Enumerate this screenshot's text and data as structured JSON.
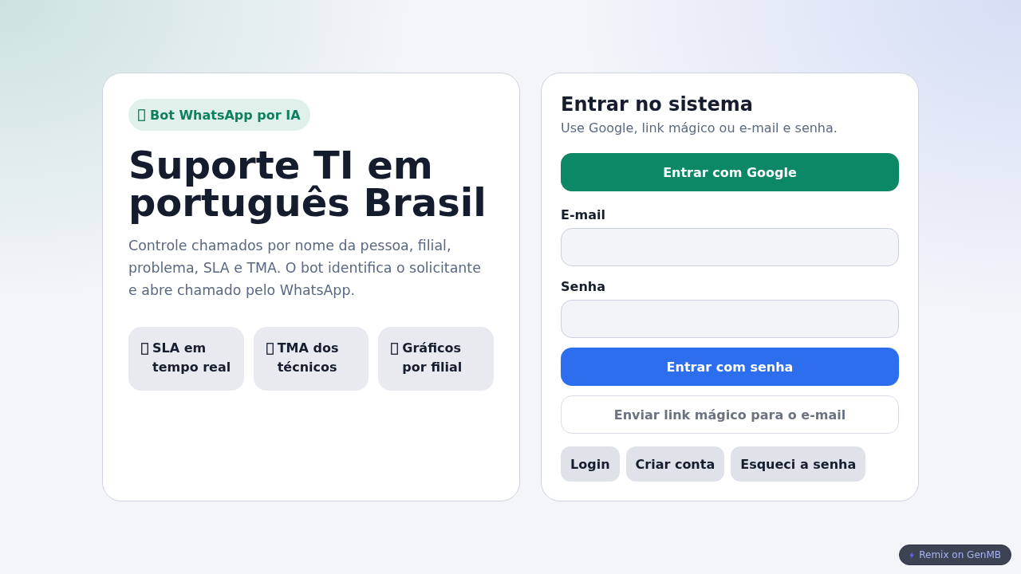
{
  "intro": {
    "badge": "Bot WhatsApp por IA",
    "title": "Suporte TI em português Brasil",
    "description": "Controle chamados por nome da pessoa, filial, problema, SLA e TMA. O bot identifica o solicitante e abre chamado pelo WhatsApp.",
    "features": [
      "SLA em tempo real",
      "TMA dos técnicos",
      "Gráficos por filial"
    ]
  },
  "login": {
    "title": "Entrar no sistema",
    "subtitle": "Use Google, link mágico ou e-mail e senha.",
    "google_button": "Entrar com Google",
    "fields": [
      {
        "label": "E-mail"
      },
      {
        "label": "Senha"
      }
    ],
    "password_button": "Entrar com senha",
    "magic_link_button": "Enviar link mágico para o e-mail",
    "mode_buttons": [
      "Login",
      "Criar conta",
      "Esqueci a senha"
    ]
  },
  "remix_button": "Remix on GenMB"
}
